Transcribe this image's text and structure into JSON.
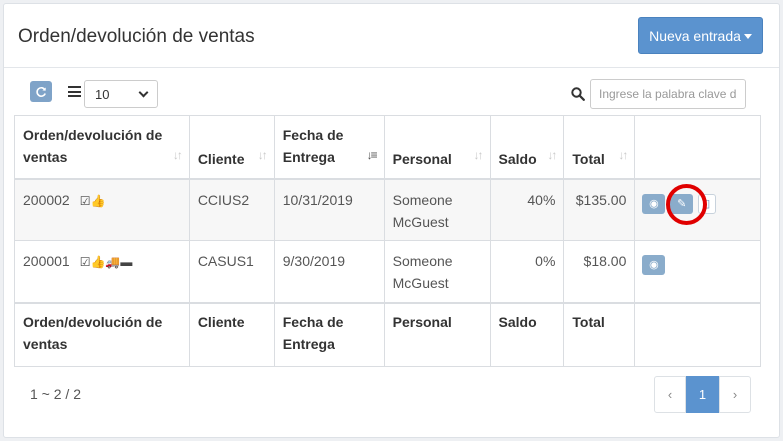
{
  "header": {
    "title": "Orden/devolución de ventas",
    "new_button_label": "Nueva entrada"
  },
  "toolbar": {
    "page_size": "10",
    "search_placeholder": "Ingrese la palabra clave d"
  },
  "table": {
    "columns": [
      {
        "label": "Orden/devolución de ventas"
      },
      {
        "label": "Cliente"
      },
      {
        "label": "Fecha de Entrega"
      },
      {
        "label": "Personal"
      },
      {
        "label": "Saldo"
      },
      {
        "label": "Total"
      }
    ],
    "rows": [
      {
        "order": "200002",
        "status_icons": "☑👍",
        "client": "CCIUS2",
        "date": "10/31/2019",
        "staff": "Someone McGuest",
        "balance": "40%",
        "total": "$135.00"
      },
      {
        "order": "200001",
        "status_icons": "☑👍🚚▬",
        "client": "CASUS1",
        "date": "9/30/2019",
        "staff": "Someone McGuest",
        "balance": "0%",
        "total": "$18.00"
      }
    ],
    "footer": {
      "order": "Orden/devolución de ventas",
      "client": "Cliente",
      "date": "Fecha de Entrega",
      "staff": "Personal",
      "balance": "Saldo",
      "total": "Total"
    }
  },
  "pagination": {
    "info": "1 ~ 2 / 2",
    "prev": "‹",
    "current": "1",
    "next": "›"
  },
  "icons": {
    "refresh": "refresh-icon",
    "list": "list-icon",
    "search": "search-icon",
    "view": "eye-icon",
    "edit": "edit-icon",
    "document": "document-icon"
  },
  "colors": {
    "accent": "#5b93cf",
    "action_button": "#8aaccb",
    "highlight": "#e00000"
  }
}
